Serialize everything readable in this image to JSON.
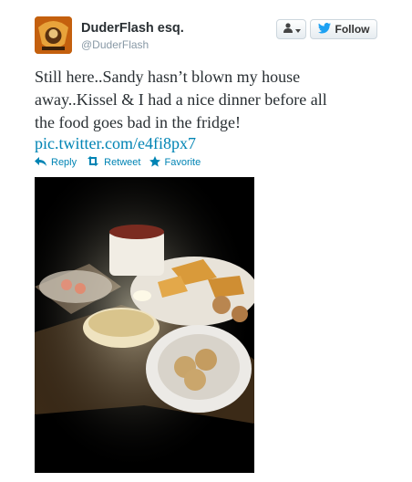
{
  "tweet": {
    "author": {
      "name": "DuderFlash esq.",
      "handle": "@DuderFlash",
      "avatar_icon": "logo-avatar"
    },
    "buttons": {
      "user_menu_icon": "user-dropdown-icon",
      "follow_label": "Follow",
      "follow_icon": "twitter-bird-icon"
    },
    "text_lines": [
      "Still here..Sandy hasn’t blown my house",
      "away..Kissel & I had a nice dinner before all",
      "the food goes bad in the fridge!"
    ],
    "link_text": "pic.twitter.com/e4fi8px7",
    "actions": {
      "reply": "Reply",
      "retweet": "Retweet",
      "favorite": "Favorite"
    },
    "colors": {
      "link": "#0084b4",
      "name": "#292f33",
      "handle": "#8899a6"
    }
  }
}
